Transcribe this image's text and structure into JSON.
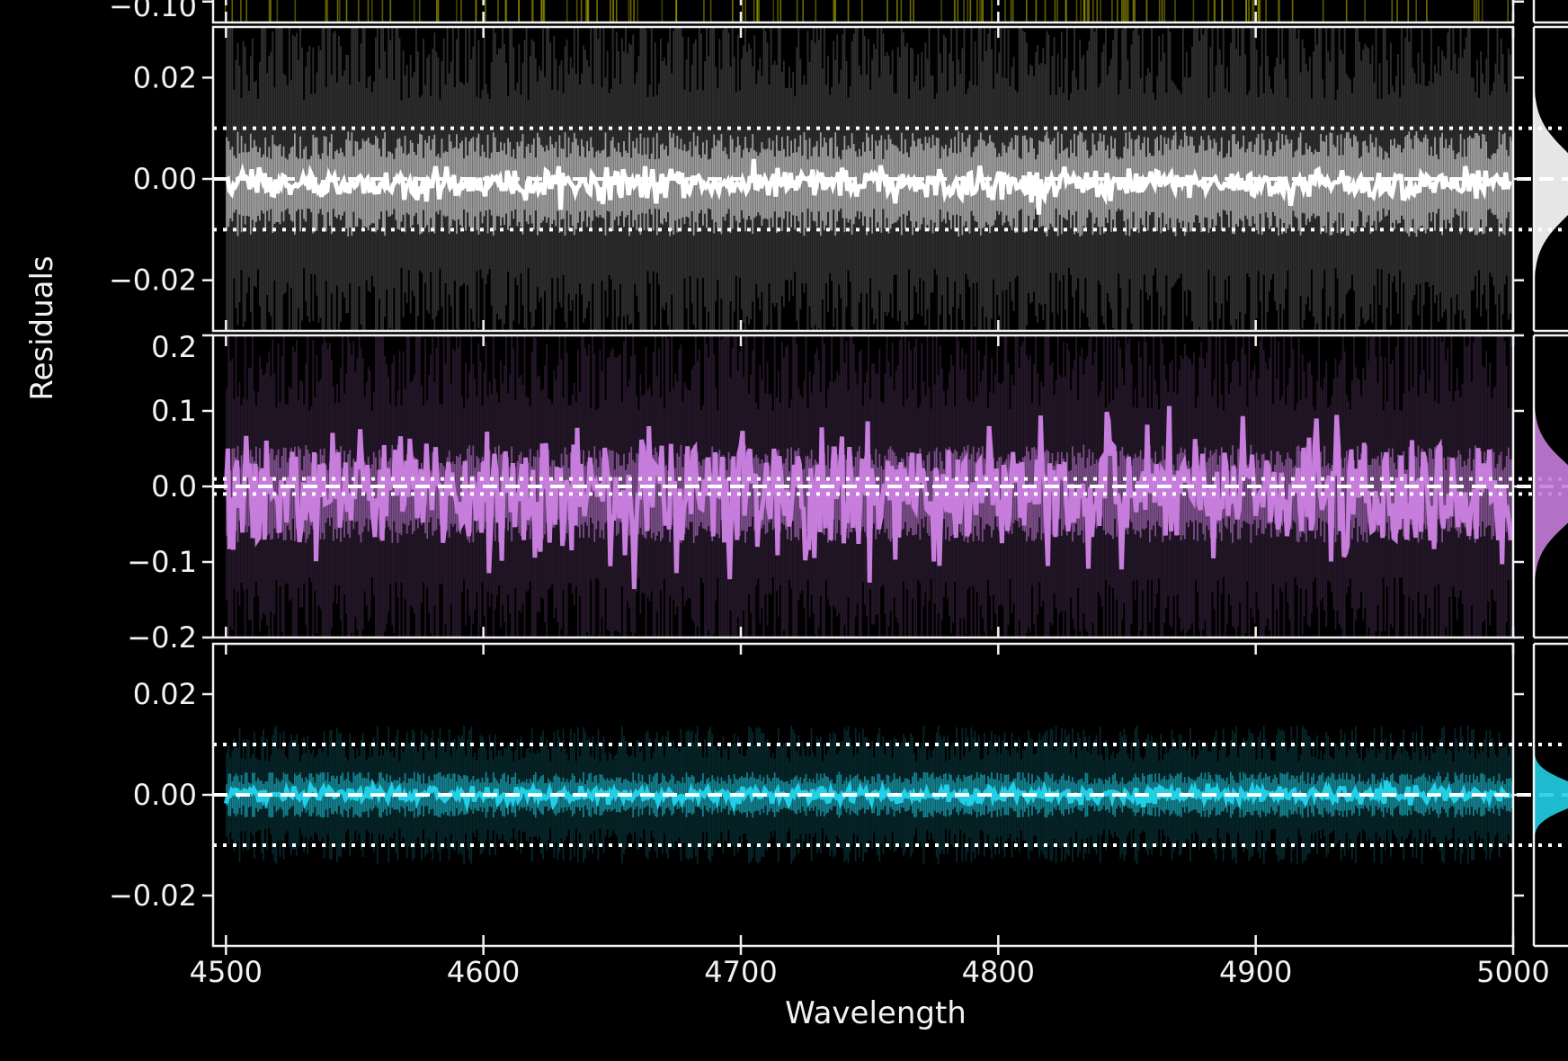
{
  "chart_data": {
    "type": "line",
    "xlabel": "Wavelength",
    "ylabel": "Residuals",
    "xlim": [
      4495,
      5000
    ],
    "xticks": [
      4500,
      4600,
      4700,
      4800,
      4900,
      5000
    ],
    "xtick_labels": [
      "4500",
      "4600",
      "4700",
      "4800",
      "4900",
      "5000"
    ],
    "panels": [
      {
        "id": "top-partial",
        "color": "#b5b300",
        "ylim": [
          -0.115,
          -0.095
        ],
        "yticks": [
          -0.1
        ],
        "ytick_labels": [
          "−0.10"
        ],
        "series": []
      },
      {
        "id": "white",
        "color": "#ffffff",
        "ylim": [
          -0.03,
          0.03
        ],
        "yticks": [
          0.02,
          0.0,
          -0.02
        ],
        "ytick_labels": [
          "0.02",
          "0.00",
          "−0.02"
        ],
        "hlines": {
          "dashed": [
            0.0
          ],
          "dotted": [
            0.01,
            -0.01
          ]
        },
        "residual": {
          "mean": -0.001,
          "line_std": 0.0015,
          "inner_band": 0.008,
          "outer_band": 0.03
        }
      },
      {
        "id": "violet",
        "color": "#c77ddc",
        "ylim": [
          -0.2,
          0.2
        ],
        "yticks": [
          0.2,
          0.1,
          0.0,
          -0.1,
          -0.2
        ],
        "ytick_labels": [
          "0.2",
          "0.1",
          "0.0",
          "−0.1",
          "−0.2"
        ],
        "hlines": {
          "dashed": [
            0.0
          ],
          "dotted": [
            0.01,
            -0.01
          ]
        },
        "residual": {
          "mean": -0.01,
          "line_std": 0.04,
          "inner_band": 0.05,
          "outer_band": 0.2
        }
      },
      {
        "id": "cyan",
        "color": "#21cfe6",
        "ylim": [
          -0.03,
          0.03
        ],
        "yticks": [
          0.02,
          0.0,
          -0.02
        ],
        "ytick_labels": [
          "0.02",
          "0.00",
          "−0.02"
        ],
        "hlines": {
          "dashed": [
            0.0
          ],
          "dotted": [
            0.01,
            -0.01
          ]
        },
        "residual": {
          "mean": 0.0,
          "line_std": 0.0008,
          "inner_band": 0.0035,
          "outer_band": 0.012
        }
      }
    ]
  }
}
